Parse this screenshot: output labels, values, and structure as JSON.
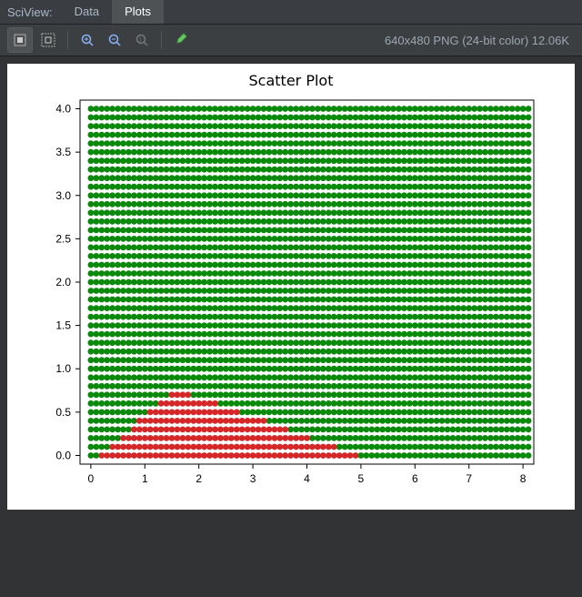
{
  "titlebar": {
    "app": "SciView:",
    "tabs": [
      "Data",
      "Plots"
    ],
    "active_tab": 1
  },
  "toolbar": {
    "tools": [
      "fit-icon",
      "actual-size-icon",
      "zoom-in-icon",
      "zoom-out-icon",
      "zoom-reset-icon",
      "eyedropper-icon"
    ],
    "status": "640x480 PNG (24-bit color) 12.06K"
  },
  "chart_data": {
    "type": "scatter",
    "title": "Scatter Plot",
    "xlabel": "",
    "ylabel": "",
    "xlim": [
      -0.2,
      8.2
    ],
    "ylim": [
      -0.1,
      4.1
    ],
    "xticks": [
      0,
      1,
      2,
      3,
      4,
      5,
      6,
      7,
      8
    ],
    "yticks": [
      0.0,
      0.5,
      1.0,
      1.5,
      2.0,
      2.5,
      3.0,
      3.5,
      4.0
    ],
    "grid_step": 0.1,
    "series": [
      {
        "name": "green",
        "color": "#0a8a0a",
        "region": {
          "description": "dense 0.1-spaced grid covering x∈[0,8.1], y∈[0,4.05] except red triangle region",
          "x_range": [
            0,
            8.1
          ],
          "y_range": [
            0,
            4.05
          ]
        }
      },
      {
        "name": "red",
        "color": "#d62728",
        "region": {
          "description": "triangular bump, apex≈(1.55,0.75), base y≈0 from x≈0.2 to x≈4.9",
          "apex": [
            1.55,
            0.75
          ],
          "base_x": [
            0.2,
            4.9
          ],
          "base_y": 0
        }
      }
    ]
  }
}
